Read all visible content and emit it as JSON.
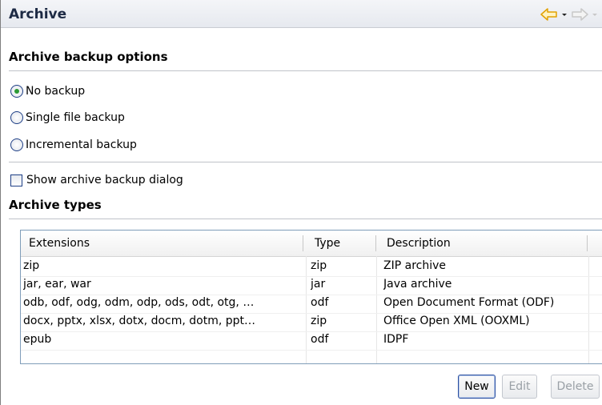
{
  "header": {
    "title": "Archive",
    "back_icon": "back-arrow-icon",
    "forward_icon": "forward-arrow-icon"
  },
  "backup_options": {
    "title": "Archive backup options",
    "options": [
      {
        "label": "No backup",
        "checked": true
      },
      {
        "label": "Single file backup",
        "checked": false
      },
      {
        "label": "Incremental backup",
        "checked": false
      }
    ],
    "show_dialog_label": "Show archive backup dialog",
    "show_dialog_checked": false
  },
  "archive_types": {
    "title": "Archive types",
    "columns": [
      "Extensions",
      "Type",
      "Description"
    ],
    "rows": [
      [
        "zip",
        "zip",
        "ZIP archive"
      ],
      [
        "jar, ear, war",
        "jar",
        "Java archive"
      ],
      [
        "odb, odf, odg, odm, odp, ods, odt, otg, …",
        "odf",
        "Open Document Format (ODF)"
      ],
      [
        "docx, pptx, xlsx, dotx, docm, dotm, ppt…",
        "zip",
        "Office Open XML (OOXML)"
      ],
      [
        "epub",
        "odf",
        "IDPF"
      ]
    ]
  },
  "buttons": {
    "new": "New",
    "edit": "Edit",
    "delete": "Delete"
  },
  "colors": {
    "accent_arrow": "#f0b400",
    "radio_selected": "#2c9a35"
  }
}
